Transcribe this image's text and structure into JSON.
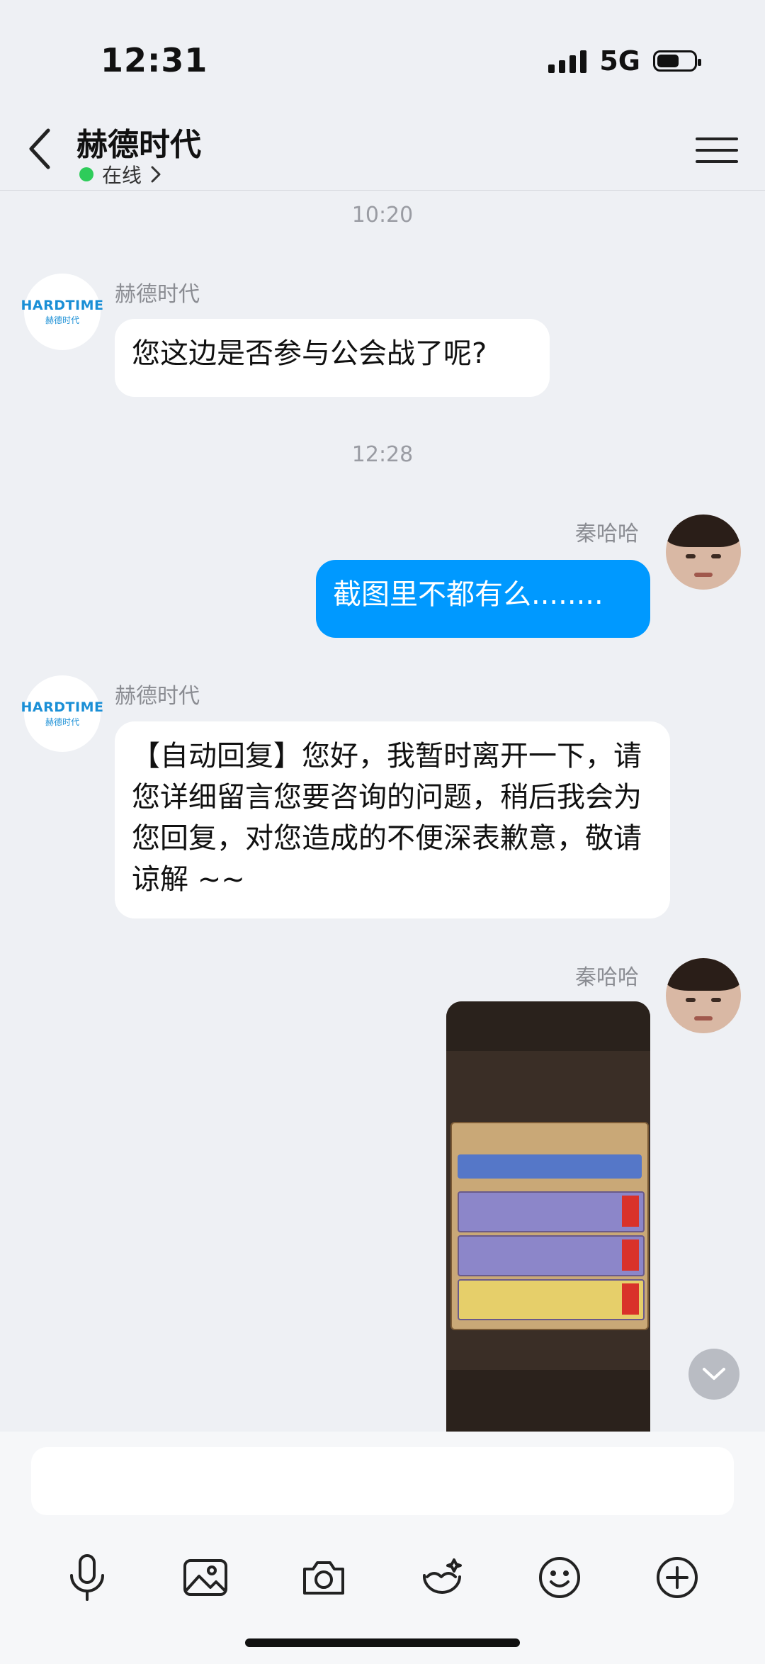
{
  "status_bar": {
    "time": "12:31",
    "network": "5G",
    "battery_level": 0.6
  },
  "header": {
    "title": "赫德时代",
    "status": "在线"
  },
  "messages": [
    {
      "type": "timestamp",
      "text": "10:20"
    },
    {
      "type": "incoming",
      "sender": "赫德时代",
      "avatar_logo": "HARDTIME",
      "avatar_logo_sub": "赫德时代",
      "text": "您这边是否参与公会战了呢?"
    },
    {
      "type": "timestamp",
      "text": "12:28"
    },
    {
      "type": "outgoing",
      "sender": "秦哈哈",
      "text": "截图里不都有么........"
    },
    {
      "type": "incoming",
      "sender": "赫德时代",
      "avatar_logo": "HARDTIME",
      "avatar_logo_sub": "赫德时代",
      "text": "【自动回复】您好，我暂时离开一下，请您详细留言您要咨询的问题，稍后我会为您回复，对您造成的不便深表歉意，敬请谅解 ~~"
    },
    {
      "type": "outgoing",
      "sender": "秦哈哈",
      "content": "image",
      "image_description_icon": "game-screenshot"
    }
  ],
  "input": {
    "value": "",
    "placeholder": ""
  },
  "toolbar": [
    "microphone-icon",
    "image-icon",
    "camera-icon",
    "sticker-icon",
    "emoji-icon",
    "plus-icon"
  ],
  "colors": {
    "outgoing_bubble": "#0099ff",
    "online": "#2ecc5a",
    "brand": "#1a8fd6"
  }
}
